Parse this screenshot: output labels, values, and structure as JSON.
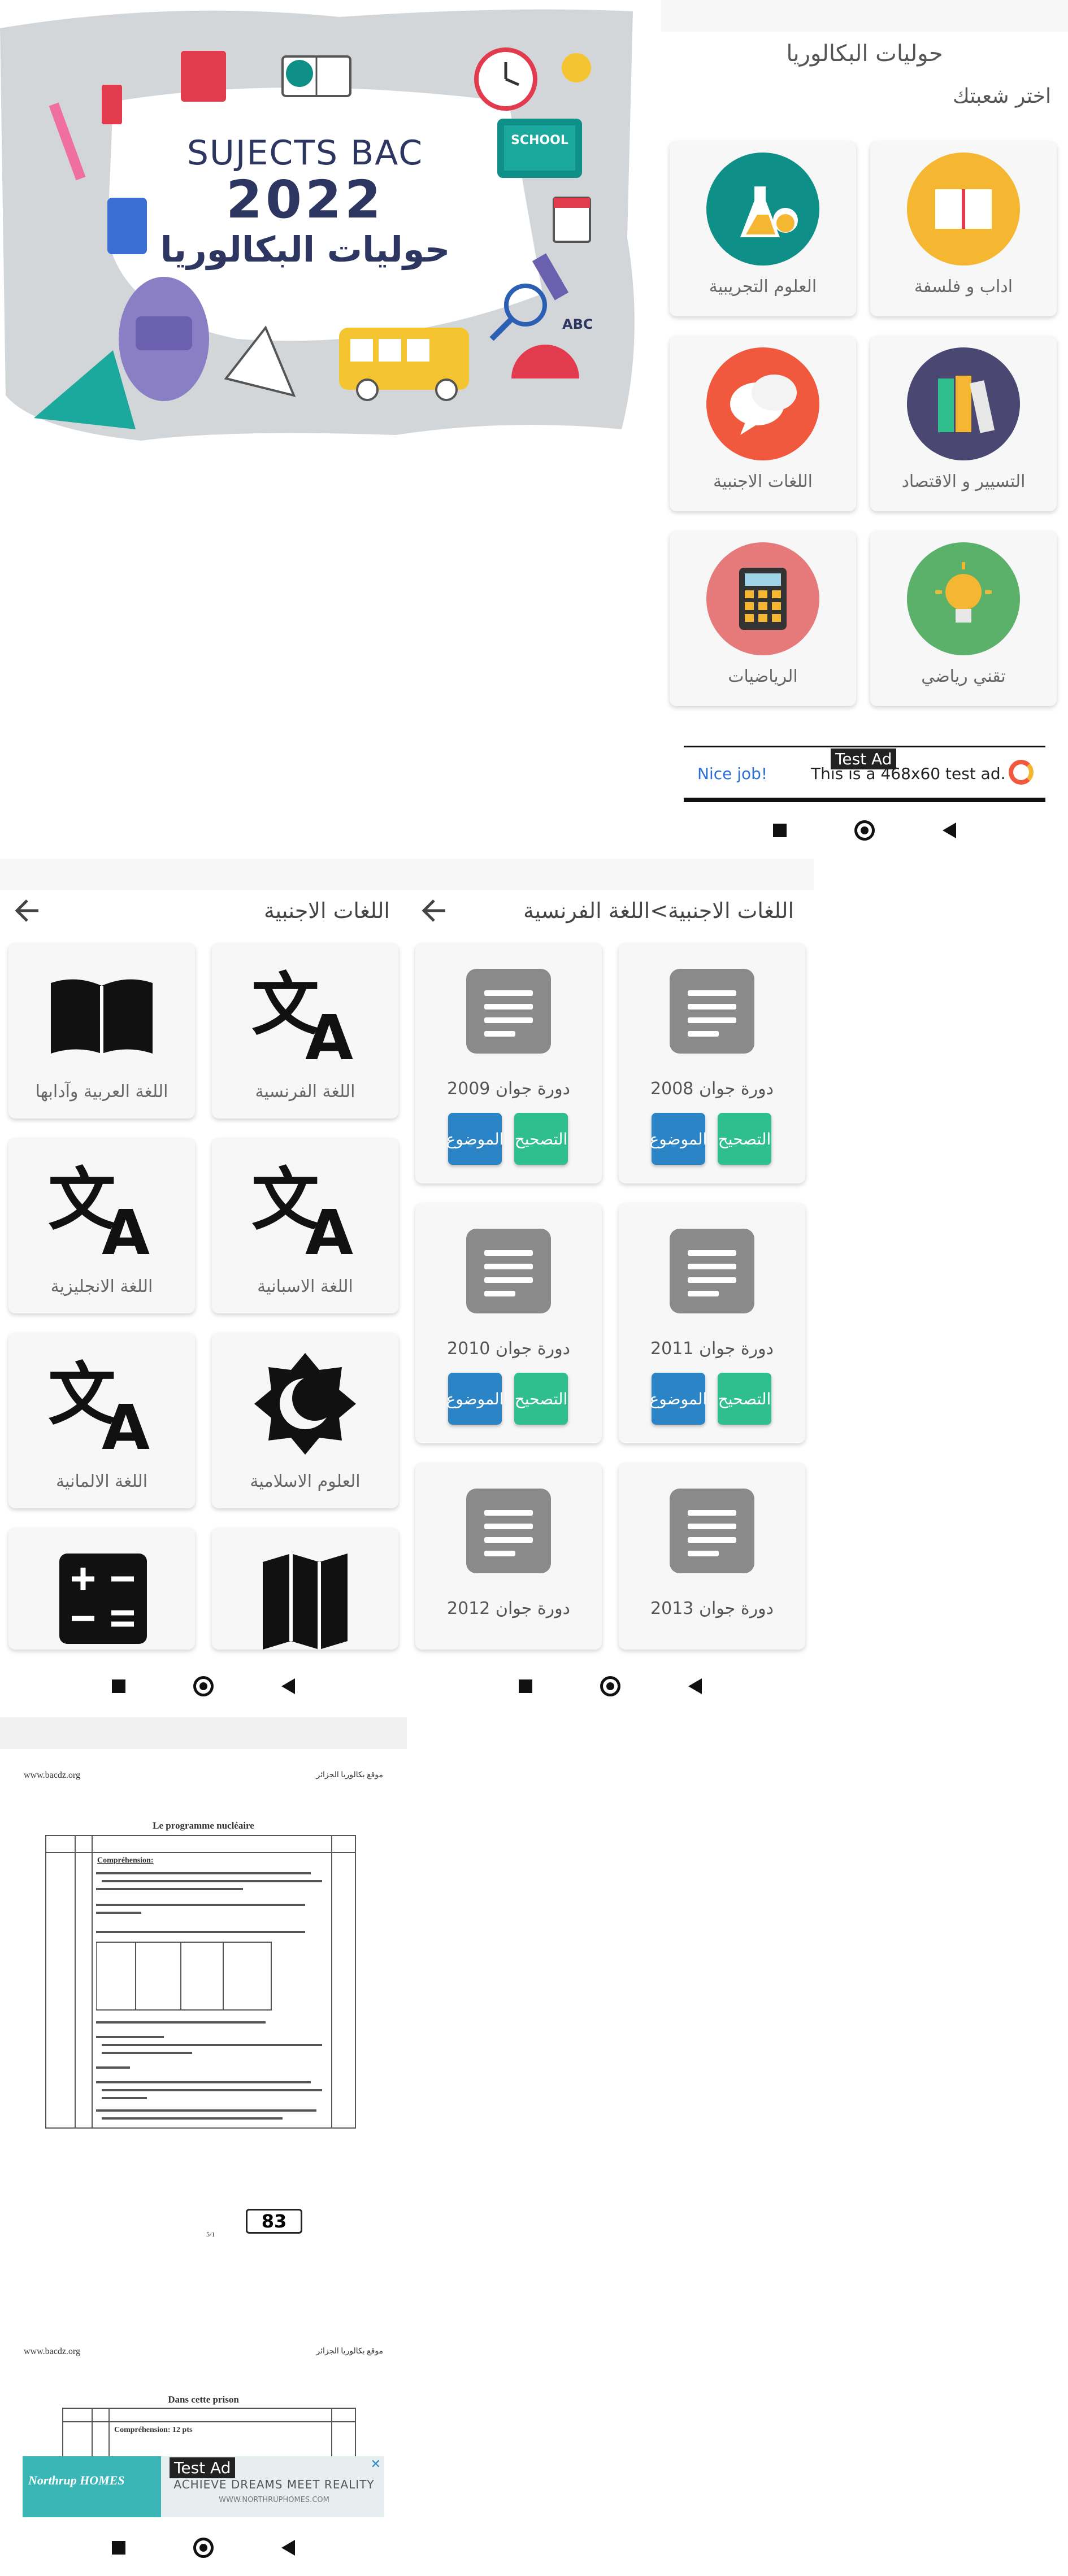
{
  "banner": {
    "line1": "SUJECTS BAC",
    "line2": "2022",
    "line3": "حوليات البكالوريا",
    "sticker_school": "SCHOOL",
    "sticker_abc": "ABC"
  },
  "home": {
    "title": "حوليات البكالوريا",
    "subtitle": "اختر شعبتك",
    "branches": [
      {
        "label": "اداب و فلسفة",
        "icon": "open-book-icon",
        "color": "#f5b731"
      },
      {
        "label": "العلوم التجريبية",
        "icon": "flask-icon",
        "color": "#0e8f87"
      },
      {
        "label": "التسيير و الاقتصاد",
        "icon": "books-icon",
        "color": "#4a4772"
      },
      {
        "label": "اللغات الاجنبية",
        "icon": "chat-bubbles-icon",
        "color": "#f0593e"
      },
      {
        "label": "تقني رياضي",
        "icon": "lightbulb-icon",
        "color": "#5bb06a"
      },
      {
        "label": "الرياضيات",
        "icon": "calculator-icon",
        "color": "#e67a7a"
      }
    ],
    "ad": {
      "badge": "Test Ad",
      "cta": "Nice job!",
      "text": "This is a 468x60 test ad."
    }
  },
  "languages": {
    "title": "اللغات الاجنبية",
    "items": [
      {
        "label": "اللغة الفرنسية",
        "icon": "translate-icon"
      },
      {
        "label": "اللغة العربية وآدابها",
        "icon": "book-icon"
      },
      {
        "label": "اللغة الاسبانية",
        "icon": "translate-icon"
      },
      {
        "label": "اللغة الانجليزية",
        "icon": "translate-icon"
      },
      {
        "label": "العلوم الاسلامية",
        "icon": "crescent-icon"
      },
      {
        "label": "اللغة الالمانية",
        "icon": "translate-icon"
      },
      {
        "label": "",
        "icon": "map-icon"
      },
      {
        "label": "",
        "icon": "calculator-icon"
      }
    ]
  },
  "french": {
    "title": "اللغات الاجنبية>اللغة الفرنسية",
    "correction_label": "التصحيح",
    "subject_label": "الموضوع",
    "sessions": [
      {
        "label": "دورة جوان 2008"
      },
      {
        "label": "دورة جوان 2009"
      },
      {
        "label": "دورة جوان 2011"
      },
      {
        "label": "دورة جوان 2010"
      },
      {
        "label": "دورة جوان 2013"
      },
      {
        "label": "دورة جوان 2012"
      }
    ]
  },
  "pdf": {
    "site_left": "www.bacdz.org",
    "site_right": "موقع بكالوريا الجزائر",
    "page1_heading": "Le programme nucléaire",
    "page1_q1": "Compréhension:",
    "page_number": "83",
    "page_label": "5/1",
    "page2_heading": "Dans cette prison",
    "page2_q1": "Compréhension: 12 pts",
    "ad": {
      "badge": "Test Ad",
      "brand": "Northrup HOMES",
      "text": "ACHIEVE DREAMS MEET REALITY",
      "url": "WWW.NORTHRUPHOMES.COM"
    }
  }
}
